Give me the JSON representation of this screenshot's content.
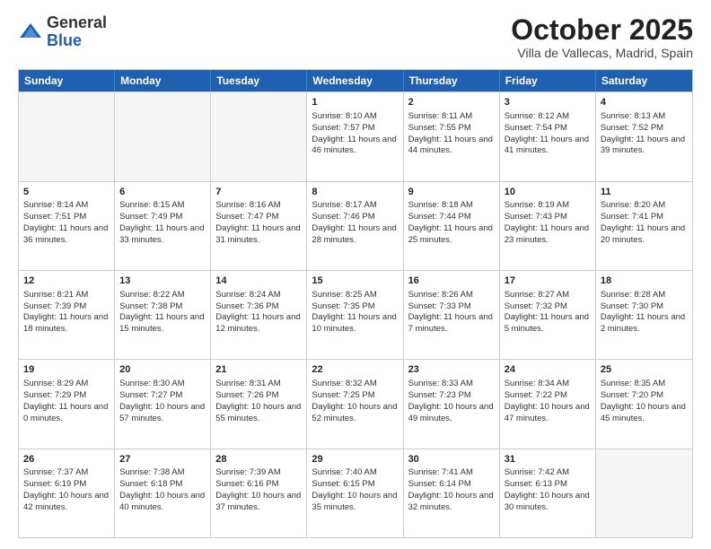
{
  "header": {
    "logo_general": "General",
    "logo_blue": "Blue",
    "month": "October 2025",
    "location": "Villa de Vallecas, Madrid, Spain"
  },
  "days_of_week": [
    "Sunday",
    "Monday",
    "Tuesday",
    "Wednesday",
    "Thursday",
    "Friday",
    "Saturday"
  ],
  "weeks": [
    [
      {
        "num": "",
        "sunrise": "",
        "sunset": "",
        "daylight": ""
      },
      {
        "num": "",
        "sunrise": "",
        "sunset": "",
        "daylight": ""
      },
      {
        "num": "",
        "sunrise": "",
        "sunset": "",
        "daylight": ""
      },
      {
        "num": "1",
        "sunrise": "Sunrise: 8:10 AM",
        "sunset": "Sunset: 7:57 PM",
        "daylight": "Daylight: 11 hours and 46 minutes."
      },
      {
        "num": "2",
        "sunrise": "Sunrise: 8:11 AM",
        "sunset": "Sunset: 7:55 PM",
        "daylight": "Daylight: 11 hours and 44 minutes."
      },
      {
        "num": "3",
        "sunrise": "Sunrise: 8:12 AM",
        "sunset": "Sunset: 7:54 PM",
        "daylight": "Daylight: 11 hours and 41 minutes."
      },
      {
        "num": "4",
        "sunrise": "Sunrise: 8:13 AM",
        "sunset": "Sunset: 7:52 PM",
        "daylight": "Daylight: 11 hours and 39 minutes."
      }
    ],
    [
      {
        "num": "5",
        "sunrise": "Sunrise: 8:14 AM",
        "sunset": "Sunset: 7:51 PM",
        "daylight": "Daylight: 11 hours and 36 minutes."
      },
      {
        "num": "6",
        "sunrise": "Sunrise: 8:15 AM",
        "sunset": "Sunset: 7:49 PM",
        "daylight": "Daylight: 11 hours and 33 minutes."
      },
      {
        "num": "7",
        "sunrise": "Sunrise: 8:16 AM",
        "sunset": "Sunset: 7:47 PM",
        "daylight": "Daylight: 11 hours and 31 minutes."
      },
      {
        "num": "8",
        "sunrise": "Sunrise: 8:17 AM",
        "sunset": "Sunset: 7:46 PM",
        "daylight": "Daylight: 11 hours and 28 minutes."
      },
      {
        "num": "9",
        "sunrise": "Sunrise: 8:18 AM",
        "sunset": "Sunset: 7:44 PM",
        "daylight": "Daylight: 11 hours and 25 minutes."
      },
      {
        "num": "10",
        "sunrise": "Sunrise: 8:19 AM",
        "sunset": "Sunset: 7:43 PM",
        "daylight": "Daylight: 11 hours and 23 minutes."
      },
      {
        "num": "11",
        "sunrise": "Sunrise: 8:20 AM",
        "sunset": "Sunset: 7:41 PM",
        "daylight": "Daylight: 11 hours and 20 minutes."
      }
    ],
    [
      {
        "num": "12",
        "sunrise": "Sunrise: 8:21 AM",
        "sunset": "Sunset: 7:39 PM",
        "daylight": "Daylight: 11 hours and 18 minutes."
      },
      {
        "num": "13",
        "sunrise": "Sunrise: 8:22 AM",
        "sunset": "Sunset: 7:38 PM",
        "daylight": "Daylight: 11 hours and 15 minutes."
      },
      {
        "num": "14",
        "sunrise": "Sunrise: 8:24 AM",
        "sunset": "Sunset: 7:36 PM",
        "daylight": "Daylight: 11 hours and 12 minutes."
      },
      {
        "num": "15",
        "sunrise": "Sunrise: 8:25 AM",
        "sunset": "Sunset: 7:35 PM",
        "daylight": "Daylight: 11 hours and 10 minutes."
      },
      {
        "num": "16",
        "sunrise": "Sunrise: 8:26 AM",
        "sunset": "Sunset: 7:33 PM",
        "daylight": "Daylight: 11 hours and 7 minutes."
      },
      {
        "num": "17",
        "sunrise": "Sunrise: 8:27 AM",
        "sunset": "Sunset: 7:32 PM",
        "daylight": "Daylight: 11 hours and 5 minutes."
      },
      {
        "num": "18",
        "sunrise": "Sunrise: 8:28 AM",
        "sunset": "Sunset: 7:30 PM",
        "daylight": "Daylight: 11 hours and 2 minutes."
      }
    ],
    [
      {
        "num": "19",
        "sunrise": "Sunrise: 8:29 AM",
        "sunset": "Sunset: 7:29 PM",
        "daylight": "Daylight: 11 hours and 0 minutes."
      },
      {
        "num": "20",
        "sunrise": "Sunrise: 8:30 AM",
        "sunset": "Sunset: 7:27 PM",
        "daylight": "Daylight: 10 hours and 57 minutes."
      },
      {
        "num": "21",
        "sunrise": "Sunrise: 8:31 AM",
        "sunset": "Sunset: 7:26 PM",
        "daylight": "Daylight: 10 hours and 55 minutes."
      },
      {
        "num": "22",
        "sunrise": "Sunrise: 8:32 AM",
        "sunset": "Sunset: 7:25 PM",
        "daylight": "Daylight: 10 hours and 52 minutes."
      },
      {
        "num": "23",
        "sunrise": "Sunrise: 8:33 AM",
        "sunset": "Sunset: 7:23 PM",
        "daylight": "Daylight: 10 hours and 49 minutes."
      },
      {
        "num": "24",
        "sunrise": "Sunrise: 8:34 AM",
        "sunset": "Sunset: 7:22 PM",
        "daylight": "Daylight: 10 hours and 47 minutes."
      },
      {
        "num": "25",
        "sunrise": "Sunrise: 8:35 AM",
        "sunset": "Sunset: 7:20 PM",
        "daylight": "Daylight: 10 hours and 45 minutes."
      }
    ],
    [
      {
        "num": "26",
        "sunrise": "Sunrise: 7:37 AM",
        "sunset": "Sunset: 6:19 PM",
        "daylight": "Daylight: 10 hours and 42 minutes."
      },
      {
        "num": "27",
        "sunrise": "Sunrise: 7:38 AM",
        "sunset": "Sunset: 6:18 PM",
        "daylight": "Daylight: 10 hours and 40 minutes."
      },
      {
        "num": "28",
        "sunrise": "Sunrise: 7:39 AM",
        "sunset": "Sunset: 6:16 PM",
        "daylight": "Daylight: 10 hours and 37 minutes."
      },
      {
        "num": "29",
        "sunrise": "Sunrise: 7:40 AM",
        "sunset": "Sunset: 6:15 PM",
        "daylight": "Daylight: 10 hours and 35 minutes."
      },
      {
        "num": "30",
        "sunrise": "Sunrise: 7:41 AM",
        "sunset": "Sunset: 6:14 PM",
        "daylight": "Daylight: 10 hours and 32 minutes."
      },
      {
        "num": "31",
        "sunrise": "Sunrise: 7:42 AM",
        "sunset": "Sunset: 6:13 PM",
        "daylight": "Daylight: 10 hours and 30 minutes."
      },
      {
        "num": "",
        "sunrise": "",
        "sunset": "",
        "daylight": ""
      }
    ]
  ]
}
